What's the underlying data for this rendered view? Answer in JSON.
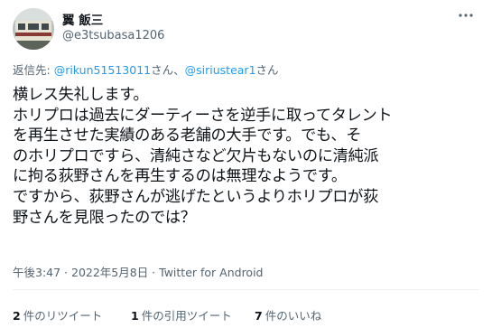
{
  "author": {
    "display_name": "翼 飯三",
    "handle": "@e3tsubasa1206",
    "avatar": "train-photo-avatar"
  },
  "more_icon": "more-dots-icon",
  "reply": {
    "prefix": "返信先: ",
    "mention1": "@rikun51513011",
    "san1": "さん、",
    "mention2": "@siriustear1",
    "san2": "さん"
  },
  "tweet": {
    "lines": [
      "横レス失礼します。",
      "ホリプロは過去にダーティーさを逆手に取ってタレント",
      "を再生させた実績のある老舗の大手です。でも、そ",
      "のホリプロですら、清純さなど欠片もないのに清純派",
      "に拘る荻野さんを再生するのは無理なようです。",
      "ですから、荻野さんが逃げたというよりホリプロが荻",
      "野さんを見限ったのでは？"
    ]
  },
  "meta": {
    "time": "午後3:47 · 2022年5月8日 · Twitter for Android"
  },
  "stats": {
    "retweets_count": "2",
    "retweets_label": "件のリツイート",
    "quotes_count": "1",
    "quotes_label": "件の引用ツイート",
    "likes_count": "7",
    "likes_label": "件のいいね"
  }
}
